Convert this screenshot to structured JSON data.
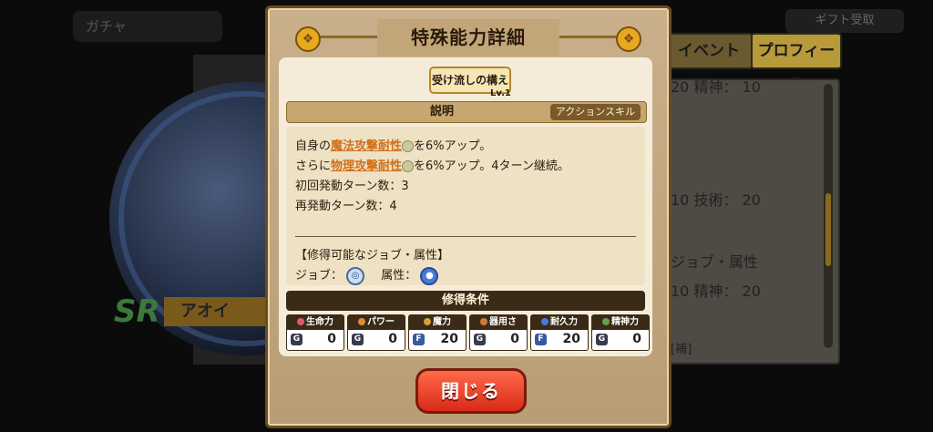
{
  "background": {
    "top_left_button": "ガチャ",
    "top_right_button": "ギフト受取",
    "tabs": {
      "event": "イベント",
      "profile": "プロフィール"
    },
    "char_name": "アオイ",
    "rarity": "SR",
    "right_panel_lines": [
      "20  精神：  10",
      "10  技術：  20",
      "ジョブ・属性",
      "10  精神：  20",
      "[補]"
    ]
  },
  "modal": {
    "title": "特殊能力詳細",
    "skill_name": "受け流しの構え",
    "skill_level": "Lv.1",
    "description": {
      "header": "説明",
      "tag": "アクションスキル",
      "line1": {
        "pre": "自身の",
        "highlight": "魔法攻撃耐性",
        "post": "を6%アップ。"
      },
      "line2": {
        "pre": "さらに",
        "highlight": "物理攻撃耐性",
        "post": "を6%アップ。4ターン継続。"
      },
      "line3": "初回発動ターン数：3",
      "line4": "再発動ターン数：4",
      "section_title": "【修得可能なジョブ・属性】",
      "job_label": "ジョブ：",
      "attr_label": "属性："
    },
    "conditions": {
      "header": "修得条件",
      "stats": [
        {
          "label": "生命力",
          "grade": "G",
          "value": "0",
          "color": "#e05a6a"
        },
        {
          "label": "パワー",
          "grade": "G",
          "value": "0",
          "color": "#e08a3a"
        },
        {
          "label": "魔力",
          "grade": "F",
          "value": "20",
          "color": "#d8a03a"
        },
        {
          "label": "器用さ",
          "grade": "G",
          "value": "0",
          "color": "#d07a3a"
        },
        {
          "label": "耐久力",
          "grade": "F",
          "value": "20",
          "color": "#4a7ad8"
        },
        {
          "label": "精神力",
          "grade": "G",
          "value": "0",
          "color": "#6aa04a"
        }
      ]
    },
    "close_button": "閉じる"
  }
}
